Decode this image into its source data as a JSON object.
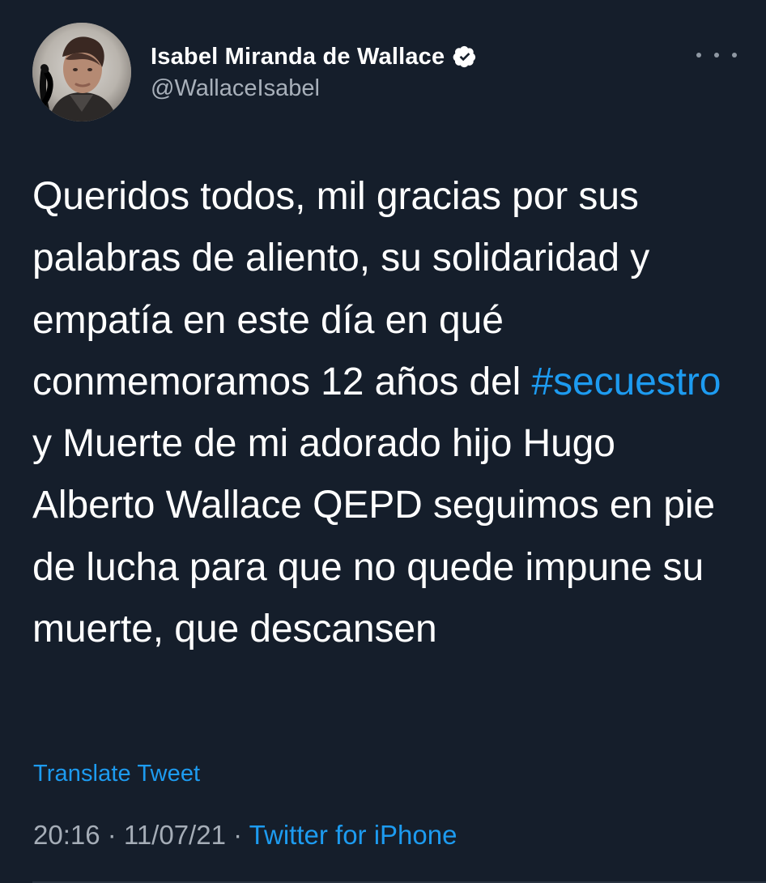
{
  "tweet": {
    "author": {
      "display_name": "Isabel Miranda de Wallace",
      "handle": "@WallaceIsabel",
      "verified_icon": "verified-badge-icon"
    },
    "more_icon": "more-options-icon",
    "text": {
      "before_hashtag": "Queridos todos, mil gracias por sus palabras de aliento, su solidaridad y empatía en este día en qué conmemoramos 12 años del ",
      "hashtag": "#secuestro",
      "after_hashtag": " y Muerte de mi adorado hijo Hugo Alberto Wallace QEPD seguimos en pie de lucha para que no quede impune su muerte, que descansen"
    },
    "translate_label": "Translate Tweet",
    "meta": {
      "time": "20:16",
      "separator_1": " · ",
      "date": "11/07/21",
      "separator_2": " · ",
      "source": "Twitter for iPhone"
    }
  },
  "colors": {
    "background": "#151e2b",
    "primary_text": "#ffffff",
    "secondary_text": "#a5adb7",
    "accent": "#1d9bf0"
  }
}
